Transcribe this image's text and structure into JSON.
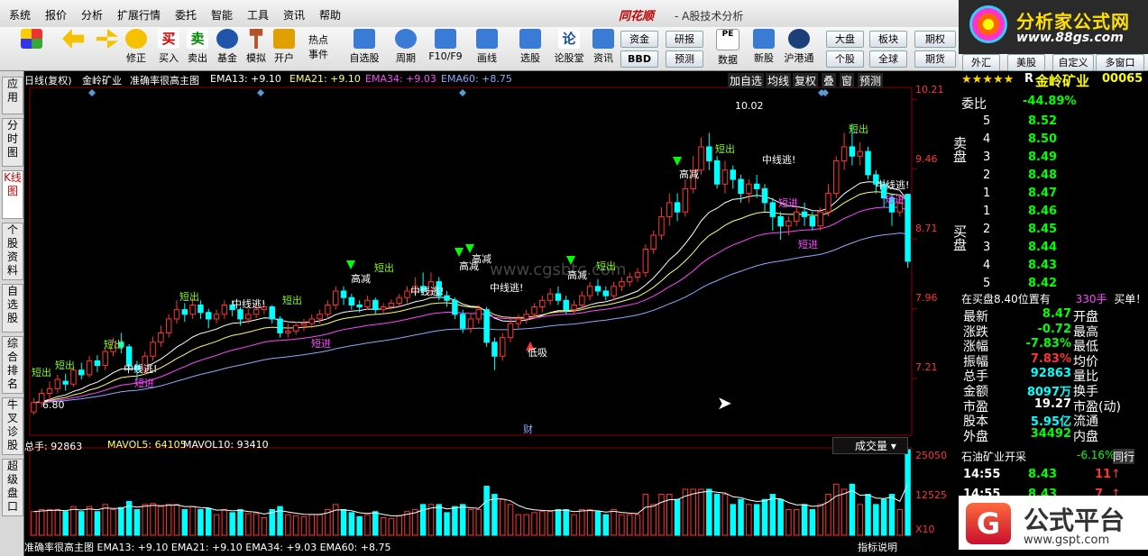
{
  "menu": [
    "系统",
    "报价",
    "分析",
    "扩展行情",
    "委托",
    "智能",
    "工具",
    "资讯",
    "帮助"
  ],
  "app": {
    "brand": "同花顺",
    "subtitle": "- A股技术分析"
  },
  "logo": {
    "title": "分析家公式网",
    "url": "www.88gs.com"
  },
  "toolbar": [
    {
      "label": "",
      "icon": "grid-icon"
    },
    {
      "label": "",
      "icon": "back-arrow-icon"
    },
    {
      "label": "",
      "icon": "up-down-icon"
    },
    {
      "label": "修正",
      "icon": "refresh-icon"
    },
    {
      "label": "买入",
      "icon": "buy-icon"
    },
    {
      "label": "卖出",
      "icon": "sell-icon"
    },
    {
      "label": "基金",
      "icon": "fund-icon"
    },
    {
      "label": "模拟",
      "icon": "hammer-icon"
    },
    {
      "label": "开户",
      "icon": "lock-icon"
    },
    {
      "label": "热点事件",
      "icon": "hot-icon"
    },
    {
      "label": "自选股",
      "icon": "star-icon"
    },
    {
      "label": "周期",
      "icon": "clock-icon"
    },
    {
      "label": "F10/F9",
      "icon": "doc-icon"
    },
    {
      "label": "画线",
      "icon": "pen-icon"
    },
    {
      "label": "选股",
      "icon": "screen-icon"
    },
    {
      "label": "论股堂",
      "icon": "chat-icon"
    },
    {
      "label": "资讯",
      "icon": "news-icon"
    }
  ],
  "toolbar_small": [
    "资金",
    "研报",
    "BBD",
    "预测",
    "数据",
    "新股",
    "沪港通",
    "大盘",
    "板块",
    "期权",
    "个股",
    "全球",
    "期货",
    "外汇",
    "美股",
    "自定义",
    "多窗口"
  ],
  "left_tabs": [
    "应用",
    "分时图",
    "K线图",
    "个股资料",
    "自选股",
    "综合排名",
    "牛叉诊股",
    "超级盘口"
  ],
  "chart": {
    "header": {
      "period": "日线(复权)",
      "stock": "金岭矿业",
      "formula": "准确率很高主图",
      "ema13": "EMA13: +9.10",
      "ema21": "EMA21: +9.10",
      "ema34": "EMA34: +9.03",
      "ema60": "EMA60: +8.75"
    },
    "top_buttons": [
      "加自选",
      "均线",
      "复权",
      "叠",
      "窗",
      "预测"
    ],
    "price_axis": [
      "10.21",
      "9.46",
      "8.71",
      "7.96",
      "7.21"
    ],
    "annotations": {
      "high": "10.02",
      "low": "6.80",
      "cai": "财",
      "watermark": "www.cgsbtc.com"
    },
    "vol_header": {
      "total": "总手: 92863",
      "mavol5": "MAVOL5: 64105",
      "mavol10": "MAVOL10: 93410"
    },
    "vol_axis": [
      "25050",
      "12525",
      "X10"
    ],
    "vol_button": "成交量",
    "footer": "准确率很高主图  EMA13: +9.10  EMA21: +9.10  EMA34: +9.03  EMA60: +8.75",
    "footer_right": "指标说明",
    "signals": {
      "duanchu": "短出",
      "duanjin": "短进",
      "zhongxian": "中线逃!",
      "gaojian": "高减",
      "dixi": "低吸"
    }
  },
  "chart_data": {
    "type": "candlestick",
    "title": "金岭矿业 日线(复权)",
    "ylim": [
      6.6,
      10.3
    ],
    "candles": [
      [
        6.85,
        6.95,
        6.82,
        7.0
      ],
      [
        6.95,
        7.05,
        6.9,
        7.1
      ],
      [
        7.05,
        7.1,
        6.98,
        7.18
      ],
      [
        7.1,
        7.2,
        7.05,
        7.25
      ],
      [
        7.18,
        7.15,
        7.08,
        7.26
      ],
      [
        7.15,
        7.3,
        7.12,
        7.35
      ],
      [
        7.3,
        7.25,
        7.2,
        7.38
      ],
      [
        7.25,
        7.4,
        7.22,
        7.45
      ],
      [
        7.4,
        7.35,
        7.28,
        7.46
      ],
      [
        7.35,
        7.5,
        7.3,
        7.55
      ],
      [
        7.5,
        7.6,
        7.45,
        7.65
      ],
      [
        7.6,
        7.55,
        7.48,
        7.7
      ],
      [
        7.55,
        7.35,
        7.3,
        7.58
      ],
      [
        7.35,
        7.3,
        7.2,
        7.4
      ],
      [
        7.3,
        7.45,
        7.25,
        7.5
      ],
      [
        7.45,
        7.6,
        7.4,
        7.66
      ],
      [
        7.6,
        7.7,
        7.55,
        7.78
      ],
      [
        7.7,
        7.85,
        7.65,
        7.9
      ],
      [
        7.85,
        7.95,
        7.8,
        8.05
      ],
      [
        7.95,
        7.9,
        7.82,
        8.02
      ],
      [
        7.9,
        8.0,
        7.85,
        8.08
      ],
      [
        8.0,
        7.92,
        7.85,
        8.05
      ],
      [
        7.92,
        7.85,
        7.75,
        7.96
      ],
      [
        7.85,
        7.9,
        7.8,
        7.95
      ],
      [
        7.9,
        8.0,
        7.85,
        8.05
      ],
      [
        8.0,
        7.95,
        7.88,
        8.05
      ],
      [
        7.95,
        7.85,
        7.78,
        7.98
      ],
      [
        7.85,
        7.9,
        7.8,
        7.96
      ],
      [
        7.9,
        7.95,
        7.86,
        8.02
      ],
      [
        7.95,
        7.98,
        7.9,
        8.02
      ],
      [
        7.98,
        7.85,
        7.8,
        8.0
      ],
      [
        7.85,
        7.7,
        7.65,
        7.88
      ],
      [
        7.7,
        7.72,
        7.65,
        7.8
      ],
      [
        7.72,
        7.78,
        7.68,
        7.82
      ],
      [
        7.78,
        7.8,
        7.72,
        7.85
      ],
      [
        7.8,
        7.85,
        7.75,
        7.9
      ],
      [
        7.85,
        7.9,
        7.8,
        7.95
      ],
      [
        7.9,
        8.0,
        7.85,
        8.05
      ],
      [
        8.0,
        8.15,
        7.95,
        8.2
      ],
      [
        8.15,
        8.08,
        8.0,
        8.2
      ],
      [
        8.08,
        8.0,
        7.95,
        8.12
      ],
      [
        8.0,
        7.98,
        7.92,
        8.05
      ],
      [
        7.98,
        8.05,
        7.95,
        8.1
      ],
      [
        8.05,
        7.95,
        7.9,
        8.08
      ],
      [
        7.95,
        7.98,
        7.9,
        8.02
      ],
      [
        7.98,
        8.02,
        7.95,
        8.06
      ],
      [
        8.02,
        8.08,
        7.98,
        8.12
      ],
      [
        8.08,
        8.15,
        8.02,
        8.2
      ],
      [
        8.15,
        8.2,
        8.1,
        8.3
      ],
      [
        8.2,
        8.15,
        8.1,
        8.35
      ],
      [
        8.15,
        8.25,
        8.1,
        8.35
      ],
      [
        8.25,
        8.1,
        8.05,
        8.3
      ],
      [
        8.1,
        8.05,
        7.98,
        8.15
      ],
      [
        8.05,
        7.9,
        7.85,
        8.08
      ],
      [
        7.9,
        7.75,
        7.7,
        7.95
      ],
      [
        7.75,
        7.85,
        7.7,
        7.9
      ],
      [
        7.85,
        7.95,
        7.8,
        8.0
      ],
      [
        7.95,
        7.6,
        7.55,
        7.98
      ],
      [
        7.6,
        7.45,
        7.3,
        7.65
      ],
      [
        7.45,
        7.65,
        7.4,
        7.7
      ],
      [
        7.65,
        7.8,
        7.6,
        7.85
      ],
      [
        7.8,
        7.85,
        7.75,
        7.9
      ],
      [
        7.85,
        7.9,
        7.8,
        7.95
      ],
      [
        7.9,
        7.98,
        7.85,
        8.02
      ],
      [
        7.98,
        8.05,
        7.92,
        8.1
      ],
      [
        8.05,
        8.12,
        8.0,
        8.18
      ],
      [
        8.12,
        8.05,
        8.0,
        8.2
      ],
      [
        8.05,
        7.95,
        7.9,
        8.1
      ],
      [
        7.95,
        8.0,
        7.9,
        8.05
      ],
      [
        8.0,
        8.1,
        7.95,
        8.15
      ],
      [
        8.1,
        8.2,
        8.05,
        8.25
      ],
      [
        8.2,
        8.15,
        8.1,
        8.28
      ],
      [
        8.15,
        8.1,
        8.05,
        8.2
      ],
      [
        8.1,
        8.2,
        8.05,
        8.25
      ],
      [
        8.2,
        8.25,
        8.15,
        8.3
      ],
      [
        8.25,
        8.3,
        8.2,
        8.35
      ],
      [
        8.3,
        8.35,
        8.25,
        8.4
      ],
      [
        8.35,
        8.6,
        8.3,
        8.65
      ],
      [
        8.6,
        8.75,
        8.55,
        8.8
      ],
      [
        8.75,
        8.95,
        8.7,
        9.05
      ],
      [
        8.95,
        9.1,
        8.85,
        9.2
      ],
      [
        9.1,
        9.0,
        8.9,
        9.2
      ],
      [
        9.0,
        9.25,
        8.95,
        9.35
      ],
      [
        9.25,
        9.45,
        9.2,
        9.6
      ],
      [
        9.45,
        9.7,
        9.4,
        9.8
      ],
      [
        9.7,
        9.55,
        9.45,
        9.85
      ],
      [
        9.55,
        9.3,
        9.25,
        9.6
      ],
      [
        9.3,
        9.45,
        9.2,
        9.55
      ],
      [
        9.45,
        9.35,
        9.25,
        9.5
      ],
      [
        9.35,
        9.2,
        9.1,
        9.4
      ],
      [
        9.2,
        9.3,
        9.1,
        9.35
      ],
      [
        9.3,
        9.25,
        9.15,
        9.4
      ],
      [
        9.25,
        9.1,
        9.0,
        9.3
      ],
      [
        9.1,
        8.95,
        8.8,
        9.15
      ],
      [
        8.95,
        8.85,
        8.7,
        9.0
      ],
      [
        8.85,
        8.9,
        8.75,
        8.95
      ],
      [
        8.9,
        9.0,
        8.85,
        9.05
      ],
      [
        9.0,
        8.95,
        8.85,
        9.1
      ],
      [
        8.95,
        8.85,
        8.8,
        9.0
      ],
      [
        8.85,
        9.0,
        8.8,
        9.05
      ],
      [
        9.0,
        9.2,
        8.95,
        9.3
      ],
      [
        9.2,
        9.55,
        9.15,
        9.6
      ],
      [
        9.55,
        9.7,
        9.45,
        9.85
      ],
      [
        9.7,
        9.6,
        9.5,
        9.95
      ],
      [
        9.6,
        9.65,
        9.5,
        9.75
      ],
      [
        9.65,
        9.4,
        9.35,
        9.7
      ],
      [
        9.4,
        9.3,
        9.2,
        9.45
      ],
      [
        9.3,
        9.15,
        9.05,
        9.35
      ],
      [
        9.15,
        9.0,
        8.85,
        9.2
      ],
      [
        9.0,
        9.1,
        8.95,
        9.15
      ],
      [
        9.19,
        8.47,
        8.4,
        9.19
      ]
    ],
    "volume_units": "手",
    "vol_ylim": [
      0,
      25050
    ]
  },
  "quote": {
    "stars": "★★★★★",
    "prefix": "R",
    "name": "金岭矿业",
    "code": "00065",
    "weibi_label": "委比",
    "weibi": "-44.89%",
    "sell_label": "卖盘",
    "buy_label": "买盘",
    "sells": [
      [
        "5",
        "8.52"
      ],
      [
        "4",
        "8.50"
      ],
      [
        "3",
        "8.49"
      ],
      [
        "2",
        "8.48"
      ],
      [
        "1",
        "8.47"
      ]
    ],
    "buys": [
      [
        "1",
        "8.46"
      ],
      [
        "2",
        "8.45"
      ],
      [
        "3",
        "8.44"
      ],
      [
        "4",
        "8.43"
      ],
      [
        "5",
        "8.42"
      ]
    ],
    "note": "在买盘8.40位置有",
    "note_qty": "330手",
    "note_tail": "买单！",
    "stats": [
      [
        "最新",
        "8.47",
        "开盘"
      ],
      [
        "涨跌",
        "-0.72",
        "最高"
      ],
      [
        "涨幅",
        "-7.83%",
        "最低"
      ],
      [
        "振幅",
        "7.83%",
        "均价"
      ],
      [
        "总手",
        "92863",
        "量比"
      ],
      [
        "金额",
        "8097万",
        "换手"
      ],
      [
        "市盈",
        "19.27",
        "市盈(动)"
      ],
      [
        "股本",
        "5.95亿",
        "流通"
      ],
      [
        "外盘",
        "34492",
        "内盘"
      ]
    ],
    "sector": "石油矿业开采",
    "sector_pct": "-6.16%",
    "sector_tab": "同行",
    "ticks": [
      [
        "14:55",
        "8.43",
        "11"
      ],
      [
        "14:55",
        "8.43",
        "7"
      ]
    ]
  },
  "colors": {
    "up": "#ff3333",
    "down": "#00ffff",
    "ema13": "#ffffff",
    "ema21": "#ffff66",
    "ema34": "#ff44ff",
    "ema60": "#8fa8ff",
    "grid": "#8b0000"
  },
  "bottom_logo": {
    "title": "公式平台",
    "url": "www.gspt.com"
  }
}
